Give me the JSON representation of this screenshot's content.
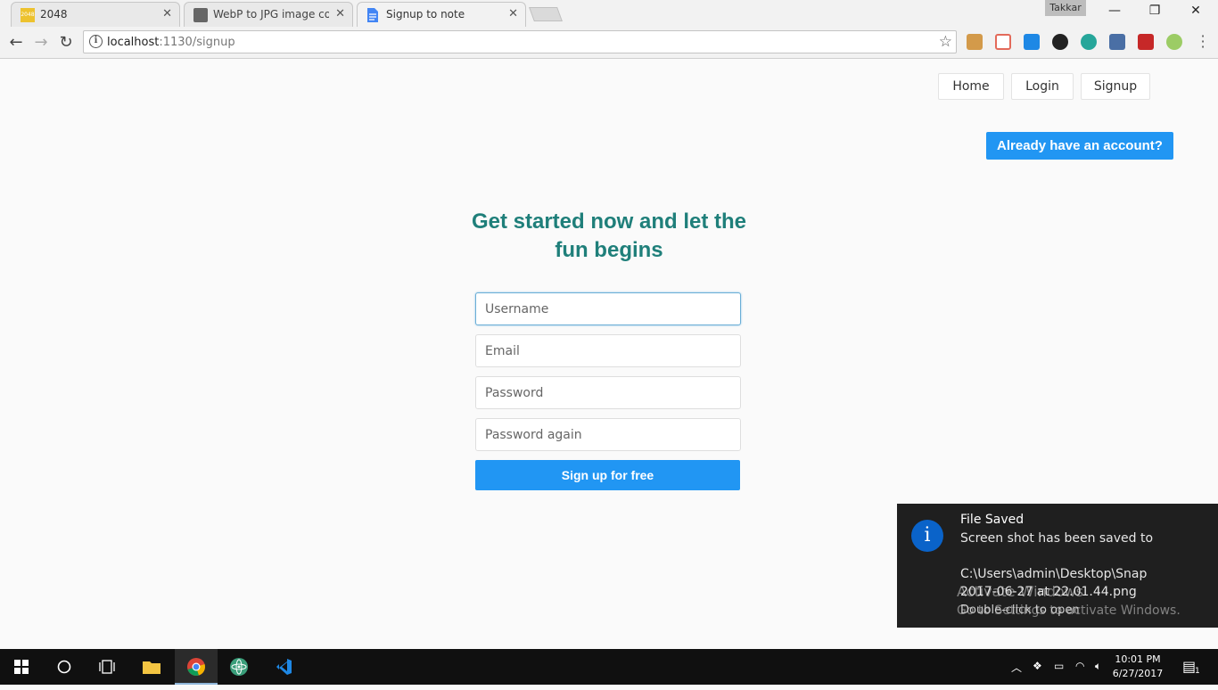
{
  "browser": {
    "tabs": [
      {
        "title": "2048",
        "favicon": "2048-icon",
        "active": false
      },
      {
        "title": "WebP to JPG image conv",
        "favicon": "converter-icon",
        "active": false
      },
      {
        "title": "Signup to note",
        "favicon": "document-icon",
        "active": true
      }
    ],
    "profile_name": "Takkar",
    "url_host": "localhost",
    "url_rest": ":1130/signup",
    "window_controls": {
      "minimize": "—",
      "restore": "❐",
      "close": "✕"
    }
  },
  "nav": {
    "home": "Home",
    "login": "Login",
    "signup": "Signup"
  },
  "page": {
    "already_button": "Already have an account?",
    "heading": "Get started now and let the fun begins",
    "form": {
      "username_placeholder": "Username",
      "email_placeholder": "Email",
      "password_placeholder": "Password",
      "password_again_placeholder": "Password again",
      "submit_label": "Sign up for free"
    }
  },
  "notification": {
    "title": "File Saved",
    "line1": "Screen shot has been saved to",
    "line2": "C:\\Users\\admin\\Desktop\\Snap",
    "line3": "2017-06-27 at 22.01.44.png",
    "line4": "Double-click to open"
  },
  "watermark": {
    "line1": "Activate Windows",
    "line2": "Go to Settings to activate Windows."
  },
  "taskbar": {
    "time": "10:01 PM",
    "date": "6/27/2017",
    "notification_count": "1"
  },
  "colors": {
    "accent": "#2196f3",
    "heading": "#1f7f7a",
    "toast_bg": "#1f1f1f",
    "info_icon": "#0a63c9"
  }
}
